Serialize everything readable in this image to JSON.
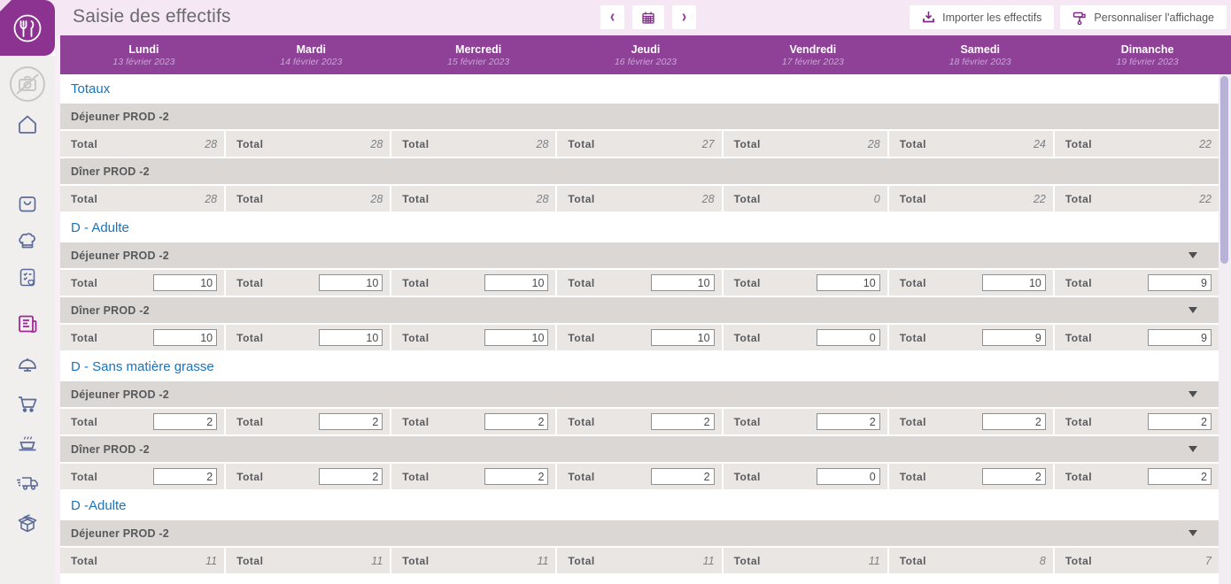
{
  "app": {
    "title": "Saisie des effectifs"
  },
  "toolbar": {
    "import_label": "Importer les effectifs",
    "customize_label": "Personnaliser l'affichage",
    "icons": {
      "prev": "chevron-left",
      "calendar": "calendar",
      "next": "chevron-right",
      "import": "download",
      "customize": "paint-roller"
    }
  },
  "week": {
    "days": [
      {
        "name": "Lundi",
        "date": "13 février 2023"
      },
      {
        "name": "Mardi",
        "date": "14 février 2023"
      },
      {
        "name": "Mercredi",
        "date": "15 février 2023"
      },
      {
        "name": "Jeudi",
        "date": "16 février 2023"
      },
      {
        "name": "Vendredi",
        "date": "17 février 2023"
      },
      {
        "name": "Samedi",
        "date": "18 février 2023"
      },
      {
        "name": "Dimanche",
        "date": "19 février 2023"
      }
    ]
  },
  "table": {
    "cell_label": "Total",
    "sections": [
      {
        "title": "Totaux",
        "groups": [
          {
            "label": "Déjeuner PROD -2",
            "collapsible": false,
            "editable": false,
            "values": [
              "28",
              "28",
              "28",
              "27",
              "28",
              "24",
              "22"
            ]
          },
          {
            "label": "Dîner PROD -2",
            "collapsible": false,
            "editable": false,
            "values": [
              "28",
              "28",
              "28",
              "28",
              "0",
              "22",
              "22"
            ]
          }
        ]
      },
      {
        "title": "D - Adulte",
        "groups": [
          {
            "label": "Déjeuner PROD -2",
            "collapsible": true,
            "editable": true,
            "values": [
              "10",
              "10",
              "10",
              "10",
              "10",
              "10",
              "9"
            ]
          },
          {
            "label": "Dîner PROD -2",
            "collapsible": true,
            "editable": true,
            "values": [
              "10",
              "10",
              "10",
              "10",
              "0",
              "9",
              "9"
            ]
          }
        ]
      },
      {
        "title": "D - Sans matière grasse",
        "groups": [
          {
            "label": "Déjeuner PROD -2",
            "collapsible": true,
            "editable": true,
            "values": [
              "2",
              "2",
              "2",
              "2",
              "2",
              "2",
              "2"
            ]
          },
          {
            "label": "Dîner PROD -2",
            "collapsible": true,
            "editable": true,
            "values": [
              "2",
              "2",
              "2",
              "2",
              "0",
              "2",
              "2"
            ]
          }
        ]
      },
      {
        "title": "D -Adulte",
        "groups": [
          {
            "label": "Déjeuner PROD -2",
            "collapsible": true,
            "editable": false,
            "values": [
              "11",
              "11",
              "11",
              "11",
              "11",
              "8",
              "7"
            ]
          }
        ]
      }
    ]
  },
  "sidebar": {
    "items": [
      "avatar-placeholder",
      "home",
      "shopping-bag",
      "chef-hat",
      "menu-checklist-heart",
      "effectifs-news",
      "cloche",
      "shopping-cart",
      "meal-bowl",
      "delivery-truck",
      "package-box"
    ]
  },
  "colors": {
    "band_purple": "#8e4197",
    "logo_purple": "#8c3290",
    "topbar_pink": "#f6e7f4",
    "section_blue": "#1c73b9",
    "group_bg": "#dad7d4",
    "row_bg": "#e9e6e4",
    "icon_purple": "#7c2a84",
    "sidebar_icon": "#5d6b97",
    "scroll_thumb": "#b8b2d9"
  }
}
